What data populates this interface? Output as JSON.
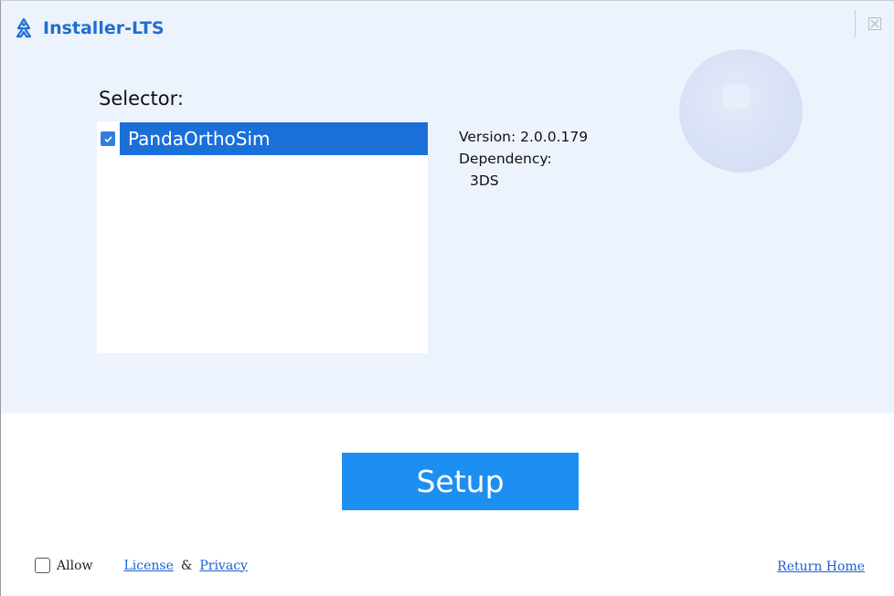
{
  "window": {
    "title": "Installer-LTS",
    "icon": "app-logo-icon",
    "close_icon": "close-icon"
  },
  "selector": {
    "label": "Selector:",
    "items": [
      {
        "label": "PandaOrthoSim",
        "checked": true,
        "selected": true
      }
    ]
  },
  "details": {
    "version": "Version: 2.0.0.179",
    "dependency_label": "Dependency:",
    "dependency_value": "3DS"
  },
  "actions": {
    "setup_label": "Setup"
  },
  "footer": {
    "allow_label": "Allow",
    "allow_checked": false,
    "license_link": "License",
    "ampersand": "&",
    "privacy_link": "Privacy",
    "return_home_link": "Return Home"
  },
  "colors": {
    "accent": "#1a6fd9",
    "button": "#1d8ff2",
    "panel": "#edf3fd",
    "title": "#1f6fd1",
    "link": "#1a5fd4"
  }
}
